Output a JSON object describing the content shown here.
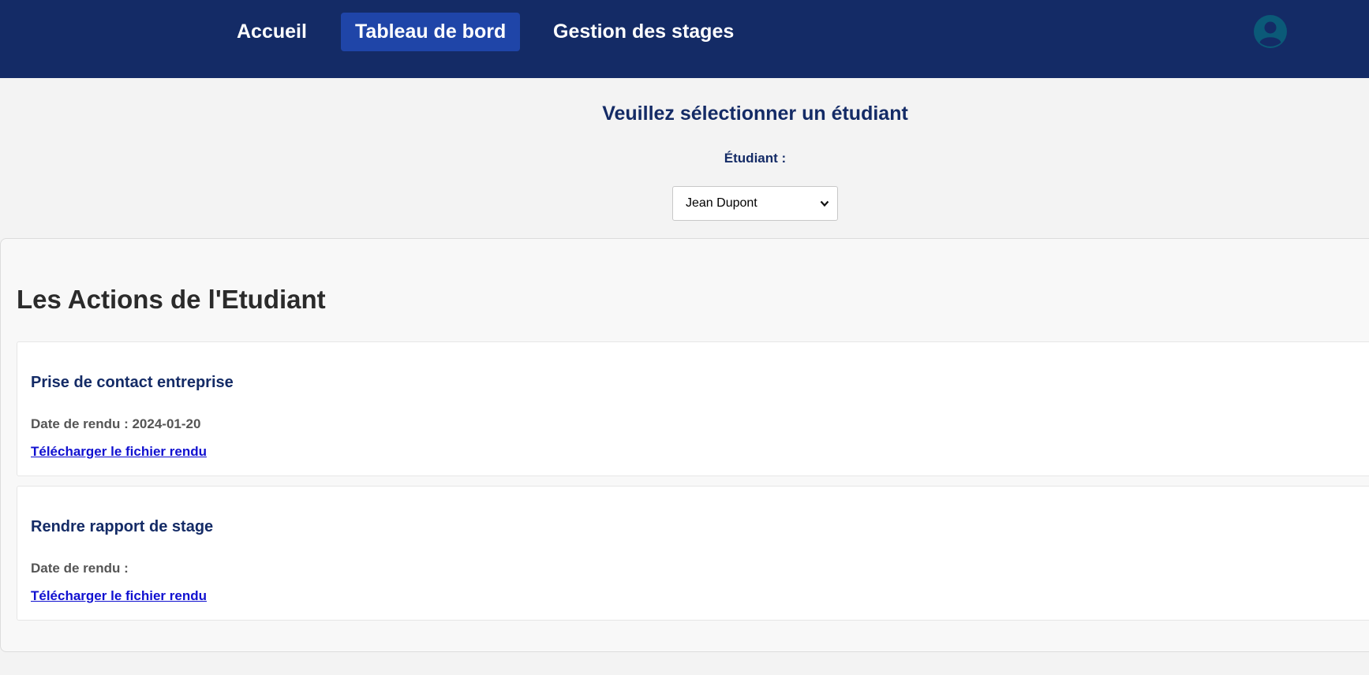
{
  "nav": {
    "items": [
      {
        "label": "Accueil",
        "active": false
      },
      {
        "label": "Tableau de bord",
        "active": true
      },
      {
        "label": "Gestion des stages",
        "active": false
      }
    ],
    "avatar_icon": "user-avatar-icon"
  },
  "student_select": {
    "title": "Veuillez sélectionner un étudiant",
    "label": "Étudiant :",
    "selected": "Jean Dupont"
  },
  "actions": {
    "title": "Les Actions de l'Etudiant",
    "items": [
      {
        "title": "Prise de contact entreprise",
        "date_label": "Date de rendu : 2024-01-20",
        "link": "Télécharger le fichier rendu"
      },
      {
        "title": "Rendre rapport de stage",
        "date_label": "Date de rendu :",
        "link": "Télécharger le fichier rendu"
      }
    ]
  },
  "colors": {
    "navbar": "#142b66",
    "nav_active": "#1f45a8",
    "heading": "#142b66",
    "link": "#1010d0",
    "avatar": "#0b5a78"
  }
}
